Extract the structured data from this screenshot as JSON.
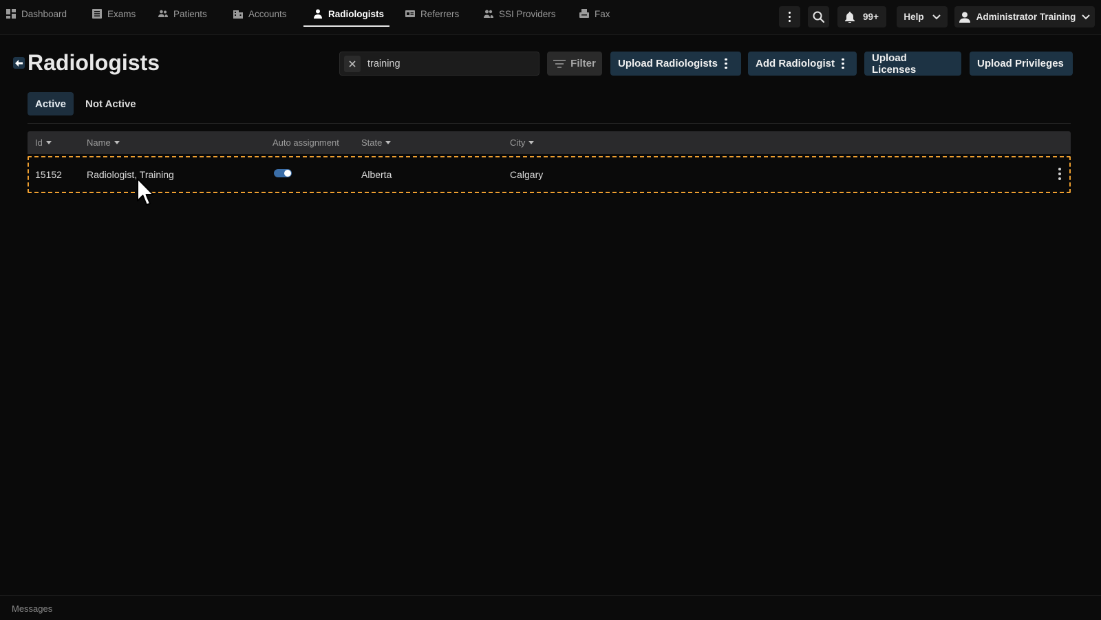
{
  "nav": {
    "items": [
      {
        "label": "Dashboard",
        "icon": "dashboard-icon"
      },
      {
        "label": "Exams",
        "icon": "exams-icon"
      },
      {
        "label": "Patients",
        "icon": "patients-icon"
      },
      {
        "label": "Accounts",
        "icon": "accounts-icon"
      },
      {
        "label": "Radiologists",
        "icon": "radiologist-icon",
        "active": true
      },
      {
        "label": "Referrers",
        "icon": "referrers-icon"
      },
      {
        "label": "SSI Providers",
        "icon": "ssi-providers-icon"
      },
      {
        "label": "Fax",
        "icon": "fax-icon"
      }
    ],
    "notifications_count": "99+",
    "help_label": "Help",
    "user_name": "Administrator Training"
  },
  "page": {
    "title": "Radiologists",
    "search_value": "training",
    "filter_label": "Filter",
    "actions": {
      "upload_radiologists": "Upload Radiologists",
      "add_radiologist": "Add Radiologist",
      "upload_licenses": "Upload Licenses",
      "upload_privileges": "Upload Privileges"
    },
    "tabs": [
      {
        "label": "Active",
        "active": true
      },
      {
        "label": "Not Active",
        "active": false
      }
    ]
  },
  "table": {
    "columns": [
      "Id",
      "Name",
      "Auto assignment",
      "State",
      "City"
    ],
    "rows": [
      {
        "id": "15152",
        "name": "Radiologist, Training",
        "auto_assignment": true,
        "state": "Alberta",
        "city": "Calgary"
      }
    ]
  },
  "footer": {
    "messages_label": "Messages"
  },
  "colors": {
    "accent_button": "#1d3344",
    "selection_outline": "#f0a030",
    "toggle_on": "#3b6ea8"
  }
}
